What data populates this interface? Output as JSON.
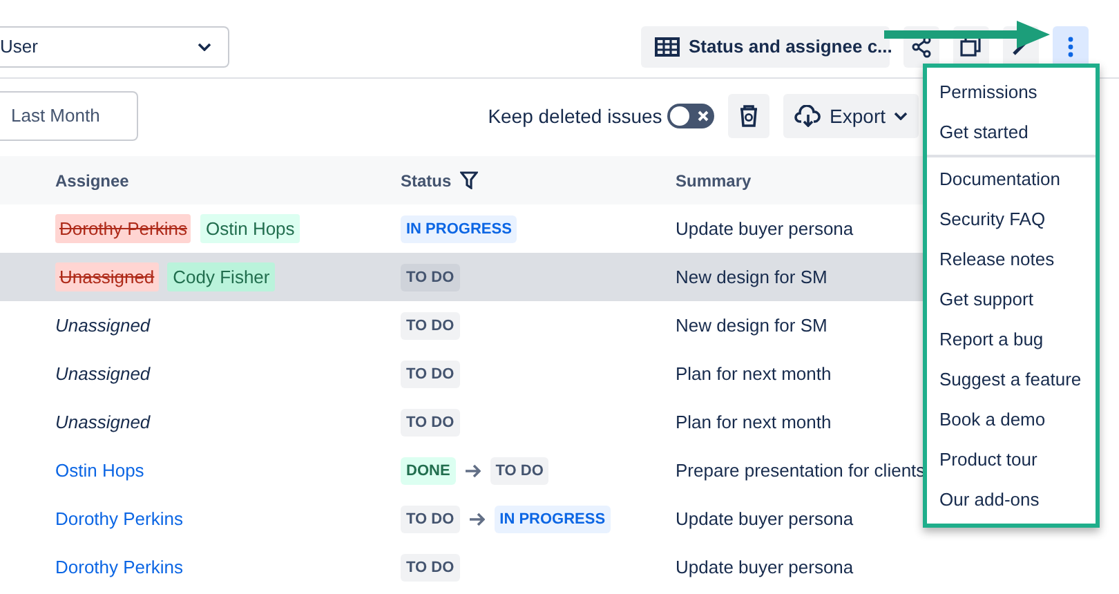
{
  "toolbar": {
    "user_select": {
      "value": "User"
    },
    "view_button": {
      "label": "Status and assignee c..."
    },
    "more_button": {
      "selected": true
    }
  },
  "filters": {
    "date": {
      "value": "Last Month"
    },
    "keep_deleted": {
      "label": "Keep deleted issues",
      "on": false
    },
    "export_button": {
      "label": "Export"
    }
  },
  "table": {
    "columns": [
      "Assignee",
      "Status",
      "Summary"
    ],
    "rows": [
      {
        "selected": false,
        "assignee": {
          "kind": "change",
          "old": "Dorothy Perkins",
          "new": "Ostin Hops"
        },
        "status": [
          {
            "kind": "inprogress",
            "label": "IN PROGRESS"
          }
        ],
        "summary": "Update buyer persona"
      },
      {
        "selected": true,
        "assignee": {
          "kind": "change",
          "old": "Unassigned",
          "new": "Cody Fisher"
        },
        "status": [
          {
            "kind": "todo",
            "label": "TO DO"
          }
        ],
        "summary": "New design for SM"
      },
      {
        "selected": false,
        "assignee": {
          "kind": "unassigned",
          "name": "Unassigned"
        },
        "status": [
          {
            "kind": "todo",
            "label": "TO DO"
          }
        ],
        "summary": "New design for SM"
      },
      {
        "selected": false,
        "assignee": {
          "kind": "unassigned",
          "name": "Unassigned"
        },
        "status": [
          {
            "kind": "todo",
            "label": "TO DO"
          }
        ],
        "summary": "Plan for next month"
      },
      {
        "selected": false,
        "assignee": {
          "kind": "unassigned",
          "name": "Unassigned"
        },
        "status": [
          {
            "kind": "todo",
            "label": "TO DO"
          }
        ],
        "summary": "Plan for next month"
      },
      {
        "selected": false,
        "assignee": {
          "kind": "user",
          "name": "Ostin Hops"
        },
        "status": [
          {
            "kind": "done",
            "label": "DONE"
          },
          {
            "kind": "todo",
            "label": "TO DO"
          }
        ],
        "summary": "Prepare presentation for clients"
      },
      {
        "selected": false,
        "assignee": {
          "kind": "user",
          "name": "Dorothy Perkins"
        },
        "status": [
          {
            "kind": "todo",
            "label": "TO DO"
          },
          {
            "kind": "inprogress",
            "label": "IN PROGRESS"
          }
        ],
        "summary": "Update buyer persona"
      },
      {
        "selected": false,
        "assignee": {
          "kind": "user",
          "name": "Dorothy Perkins"
        },
        "status": [
          {
            "kind": "todo",
            "label": "TO DO"
          }
        ],
        "summary": "Update buyer persona"
      }
    ]
  },
  "menu": {
    "groups": [
      [
        "Permissions",
        "Get started"
      ],
      [
        "Documentation",
        "Security FAQ",
        "Release notes",
        "Get support",
        "Report a bug",
        "Suggest a feature",
        "Book a demo",
        "Product tour",
        "Our add-ons"
      ]
    ]
  }
}
